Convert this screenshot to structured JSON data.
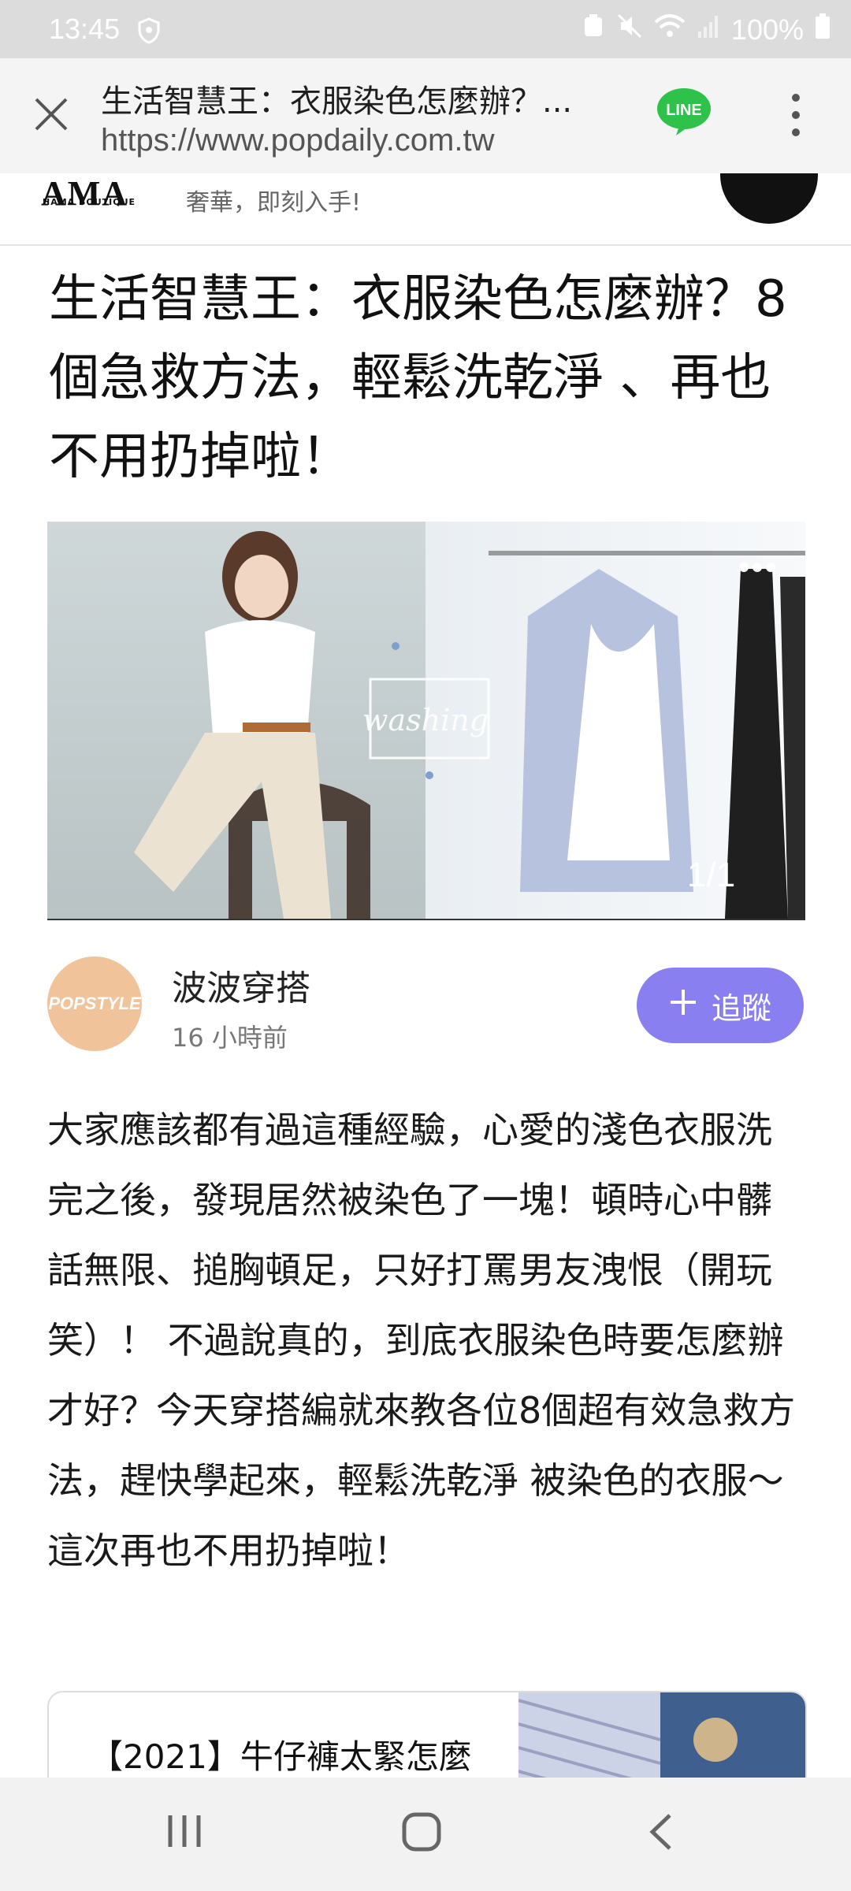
{
  "status_bar": {
    "time": "13:45",
    "battery": "100%"
  },
  "browser": {
    "page_title": "生活智慧王：衣服染色怎麼辦？...",
    "url": "https://www.popdaily.com.tw"
  },
  "ad": {
    "logo": "AMA",
    "logo_sub": "HAMA BOUTIQUE",
    "text": "奢華，即刻入手!"
  },
  "article": {
    "title": "生活智慧王：衣服染色怎麼辦？8個急救方法，輕鬆洗乾淨 、再也不用扔掉啦！",
    "image_counter": "1/1",
    "author": {
      "avatar_text": "POPSTYLE",
      "name": "波波穿搭",
      "time": "16 小時前"
    },
    "follow_label": "追蹤",
    "body": "大家應該都有過這種經驗，心愛的淺色衣服洗完之後，發現居然被染色了一塊！頓時心中髒話無限、搥胸頓足，只好打罵男友洩恨（開玩笑）！ 不過說真的，到底衣服染色時要怎麼辦才好？今天穿搭編就來教各位8個超有效急救方法，趕快學起來，輕鬆洗乾淨 被染色的衣服～這次再也不用扔掉啦！"
  },
  "related": {
    "title": "【2021】牛仔褲太緊怎麼"
  },
  "colors": {
    "follow_button": "#8a7ff0",
    "avatar_bg": "#f0c39a",
    "line_green": "#2ec24a",
    "status_bar_bg": "#dcdcdc"
  },
  "icons": [
    "shield-icon",
    "close-icon",
    "line-app-icon",
    "more-vertical-icon",
    "plus-icon",
    "recent-apps-icon",
    "home-icon",
    "back-icon"
  ]
}
